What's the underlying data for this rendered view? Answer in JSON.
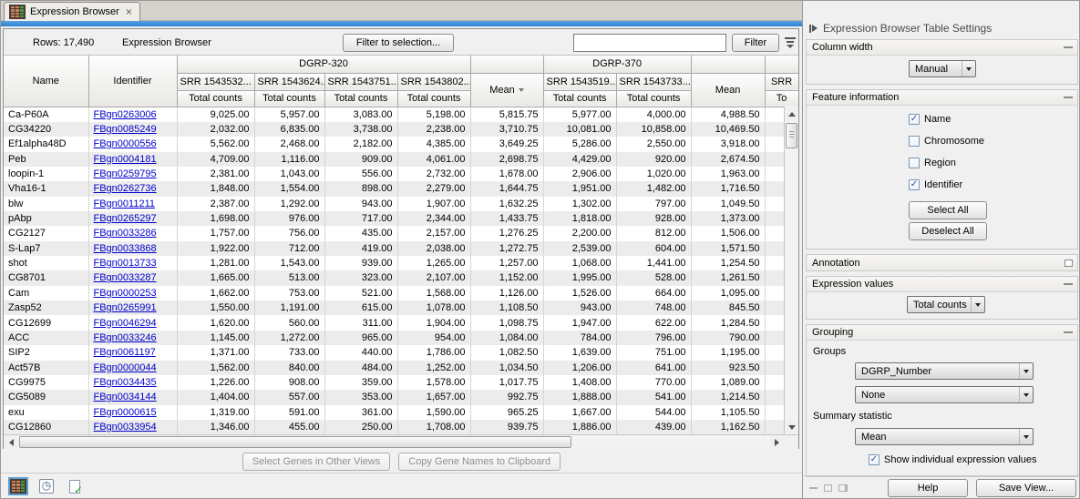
{
  "tab": {
    "title": "Expression Browser",
    "close_glyph": "×"
  },
  "toolbar": {
    "rows_label": "Rows: 17,490",
    "title": "Expression Browser",
    "filter_to_selection_label": "Filter to selection...",
    "filter_value": "",
    "filter_button_label": "Filter"
  },
  "table": {
    "col_name": "Name",
    "col_identifier": "Identifier",
    "group1": {
      "label": "DGRP-320",
      "samples": [
        "SRR 1543532...",
        "SRR 1543624...",
        "SRR 1543751...",
        "SRR 1543802..."
      ]
    },
    "group2": {
      "label": "DGRP-370",
      "samples": [
        "SRR 1543519...",
        "SRR 1543733..."
      ]
    },
    "mean_label": "Mean",
    "sort_indicator": "desc",
    "subcol_label": "Total counts",
    "clipped_col": {
      "top": "SRR",
      "bottom": "To"
    },
    "rows": [
      {
        "name": "Ca-P60A",
        "identifier": "FBgn0263006",
        "values": [
          "9,025.00",
          "5,957.00",
          "3,083.00",
          "5,198.00",
          "5,815.75",
          "5,977.00",
          "4,000.00",
          "4,988.50"
        ]
      },
      {
        "name": "CG34220",
        "identifier": "FBgn0085249",
        "values": [
          "2,032.00",
          "6,835.00",
          "3,738.00",
          "2,238.00",
          "3,710.75",
          "10,081.00",
          "10,858.00",
          "10,469.50"
        ]
      },
      {
        "name": "Ef1alpha48D",
        "identifier": "FBgn0000556",
        "values": [
          "5,562.00",
          "2,468.00",
          "2,182.00",
          "4,385.00",
          "3,649.25",
          "5,286.00",
          "2,550.00",
          "3,918.00"
        ]
      },
      {
        "name": "Peb",
        "identifier": "FBgn0004181",
        "values": [
          "4,709.00",
          "1,116.00",
          "909.00",
          "4,061.00",
          "2,698.75",
          "4,429.00",
          "920.00",
          "2,674.50"
        ]
      },
      {
        "name": "loopin-1",
        "identifier": "FBgn0259795",
        "values": [
          "2,381.00",
          "1,043.00",
          "556.00",
          "2,732.00",
          "1,678.00",
          "2,906.00",
          "1,020.00",
          "1,963.00"
        ]
      },
      {
        "name": "Vha16-1",
        "identifier": "FBgn0262736",
        "values": [
          "1,848.00",
          "1,554.00",
          "898.00",
          "2,279.00",
          "1,644.75",
          "1,951.00",
          "1,482.00",
          "1,716.50"
        ]
      },
      {
        "name": "blw",
        "identifier": "FBgn0011211",
        "values": [
          "2,387.00",
          "1,292.00",
          "943.00",
          "1,907.00",
          "1,632.25",
          "1,302.00",
          "797.00",
          "1,049.50"
        ]
      },
      {
        "name": "pAbp",
        "identifier": "FBgn0265297",
        "values": [
          "1,698.00",
          "976.00",
          "717.00",
          "2,344.00",
          "1,433.75",
          "1,818.00",
          "928.00",
          "1,373.00"
        ]
      },
      {
        "name": "CG2127",
        "identifier": "FBgn0033286",
        "values": [
          "1,757.00",
          "756.00",
          "435.00",
          "2,157.00",
          "1,276.25",
          "2,200.00",
          "812.00",
          "1,506.00"
        ]
      },
      {
        "name": "S-Lap7",
        "identifier": "FBgn0033868",
        "values": [
          "1,922.00",
          "712.00",
          "419.00",
          "2,038.00",
          "1,272.75",
          "2,539.00",
          "604.00",
          "1,571.50"
        ]
      },
      {
        "name": "shot",
        "identifier": "FBgn0013733",
        "values": [
          "1,281.00",
          "1,543.00",
          "939.00",
          "1,265.00",
          "1,257.00",
          "1,068.00",
          "1,441.00",
          "1,254.50"
        ]
      },
      {
        "name": "CG8701",
        "identifier": "FBgn0033287",
        "values": [
          "1,665.00",
          "513.00",
          "323.00",
          "2,107.00",
          "1,152.00",
          "1,995.00",
          "528.00",
          "1,261.50"
        ]
      },
      {
        "name": "Cam",
        "identifier": "FBgn0000253",
        "values": [
          "1,662.00",
          "753.00",
          "521.00",
          "1,568.00",
          "1,126.00",
          "1,526.00",
          "664.00",
          "1,095.00"
        ]
      },
      {
        "name": "Zasp52",
        "identifier": "FBgn0265991",
        "values": [
          "1,550.00",
          "1,191.00",
          "615.00",
          "1,078.00",
          "1,108.50",
          "943.00",
          "748.00",
          "845.50"
        ]
      },
      {
        "name": "CG12699",
        "identifier": "FBgn0046294",
        "values": [
          "1,620.00",
          "560.00",
          "311.00",
          "1,904.00",
          "1,098.75",
          "1,947.00",
          "622.00",
          "1,284.50"
        ]
      },
      {
        "name": "ACC",
        "identifier": "FBgn0033246",
        "values": [
          "1,145.00",
          "1,272.00",
          "965.00",
          "954.00",
          "1,084.00",
          "784.00",
          "796.00",
          "790.00"
        ]
      },
      {
        "name": "SIP2",
        "identifier": "FBgn0061197",
        "values": [
          "1,371.00",
          "733.00",
          "440.00",
          "1,786.00",
          "1,082.50",
          "1,639.00",
          "751.00",
          "1,195.00"
        ]
      },
      {
        "name": "Act57B",
        "identifier": "FBgn0000044",
        "values": [
          "1,562.00",
          "840.00",
          "484.00",
          "1,252.00",
          "1,034.50",
          "1,206.00",
          "641.00",
          "923.50"
        ]
      },
      {
        "name": "CG9975",
        "identifier": "FBgn0034435",
        "values": [
          "1,226.00",
          "908.00",
          "359.00",
          "1,578.00",
          "1,017.75",
          "1,408.00",
          "770.00",
          "1,089.00"
        ]
      },
      {
        "name": "CG5089",
        "identifier": "FBgn0034144",
        "values": [
          "1,404.00",
          "557.00",
          "353.00",
          "1,657.00",
          "992.75",
          "1,888.00",
          "541.00",
          "1,214.50"
        ]
      },
      {
        "name": "exu",
        "identifier": "FBgn0000615",
        "values": [
          "1,319.00",
          "591.00",
          "361.00",
          "1,590.00",
          "965.25",
          "1,667.00",
          "544.00",
          "1,105.50"
        ]
      },
      {
        "name": "CG12860",
        "identifier": "FBgn0033954",
        "values": [
          "1,346.00",
          "455.00",
          "250.00",
          "1,708.00",
          "939.75",
          "1,886.00",
          "439.00",
          "1,162.50"
        ]
      }
    ]
  },
  "footer": {
    "select_genes_label": "Select Genes in Other Views",
    "copy_names_label": "Copy Gene Names to Clipboard"
  },
  "settings": {
    "title": "Expression Browser Table Settings",
    "sections": {
      "column_width": {
        "label": "Column width",
        "value": "Manual"
      },
      "feature_information": {
        "label": "Feature information",
        "checkboxes": [
          {
            "label": "Name",
            "checked": true
          },
          {
            "label": "Chromosome",
            "checked": false
          },
          {
            "label": "Region",
            "checked": false
          },
          {
            "label": "Identifier",
            "checked": true
          }
        ],
        "select_all_label": "Select All",
        "deselect_all_label": "Deselect All"
      },
      "annotation": {
        "label": "Annotation"
      },
      "expression_values": {
        "label": "Expression values",
        "value": "Total counts"
      },
      "grouping": {
        "label": "Grouping",
        "groups_label": "Groups",
        "group1_value": "DGRP_Number",
        "group2_value": "None",
        "summary_label": "Summary statistic",
        "summary_value": "Mean",
        "show_individual": {
          "label": "Show individual expression values",
          "checked": true
        }
      }
    },
    "help_label": "Help",
    "save_view_label": "Save View..."
  },
  "icons": {
    "check_glyph": "✓",
    "clock_glyph": "◷"
  },
  "colors": {
    "accent_blue": "#3a8fd6",
    "link_blue": "#0000cc",
    "icon_salmon": "#c68260",
    "icon_green": "#3f9e3f"
  }
}
